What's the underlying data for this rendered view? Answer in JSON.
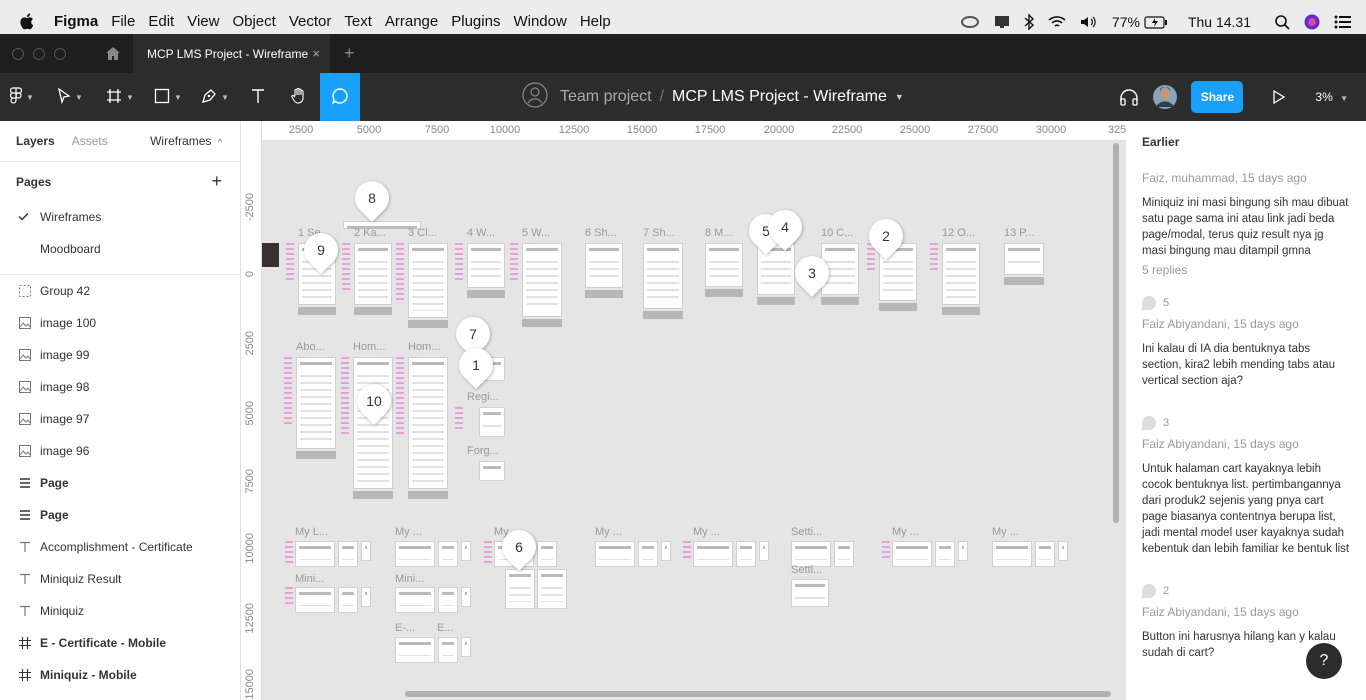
{
  "menubar": {
    "app": "Figma",
    "items": [
      "File",
      "Edit",
      "View",
      "Object",
      "Vector",
      "Text",
      "Arrange",
      "Plugins",
      "Window",
      "Help"
    ],
    "battery": "77%",
    "clock": "Thu 14.31"
  },
  "tabbar": {
    "tab_title": "MCP LMS Project - Wireframe",
    "close": "×",
    "new_tab": "+"
  },
  "toolbar": {
    "team": "Team project",
    "separator": "/",
    "file_name": "MCP LMS Project - Wireframe",
    "share_label": "Share",
    "zoom": "3%"
  },
  "left_panel": {
    "tab_layers": "Layers",
    "tab_assets": "Assets",
    "current_page_switch": "Wireframes",
    "pages_header": "Pages",
    "pages": [
      {
        "label": "Wireframes",
        "selected": true
      },
      {
        "label": "Moodboard",
        "selected": false
      }
    ],
    "layers": [
      {
        "label": "Group 42",
        "icon": "group-icon",
        "bold": false
      },
      {
        "label": "image 100",
        "icon": "image-icon",
        "bold": false
      },
      {
        "label": "image 99",
        "icon": "image-icon",
        "bold": false
      },
      {
        "label": "image 98",
        "icon": "image-icon",
        "bold": false
      },
      {
        "label": "image 97",
        "icon": "image-icon",
        "bold": false
      },
      {
        "label": "image 96",
        "icon": "image-icon",
        "bold": false
      },
      {
        "label": "Page",
        "icon": "component-list-icon",
        "bold": true
      },
      {
        "label": "Page",
        "icon": "component-list-icon",
        "bold": true
      },
      {
        "label": "Accomplishment - Certificate",
        "icon": "text-icon",
        "bold": false
      },
      {
        "label": "Miniquiz Result",
        "icon": "text-icon",
        "bold": false
      },
      {
        "label": "Miniquiz",
        "icon": "text-icon",
        "bold": false
      },
      {
        "label": "E - Certificate - Mobile",
        "icon": "frame-icon",
        "bold": true
      },
      {
        "label": "Miniquiz - Mobile",
        "icon": "frame-icon",
        "bold": true
      }
    ]
  },
  "canvas": {
    "ruler_top": [
      "2500",
      "5000",
      "7500",
      "10000",
      "12500",
      "15000",
      "17500",
      "20000",
      "22500",
      "25000",
      "27500",
      "30000",
      "325"
    ],
    "ruler_left": [
      "-2500",
      "0",
      "2500",
      "5000",
      "7500",
      "10000",
      "12500",
      "15000"
    ],
    "frame_labels": {
      "f1": "1 Se...",
      "f2": "2 Ka...",
      "f3": "3 Cl...",
      "f4": "4 W...",
      "f5": "5 W...",
      "f6": "6 Sh...",
      "f7": "7 Sh...",
      "f8": "8 M...",
      "f10": "10 C...",
      "f12": "12 O...",
      "f13": "13 P...",
      "abo": "Abo...",
      "hom1": "Hom...",
      "hom2": "Hom...",
      "regi": "Regi...",
      "forg": "Forg...",
      "myl": "My L...",
      "my1": "My ...",
      "my2": "My ...",
      "my3": "My ...",
      "my4": "My ...",
      "sett1": "Setti...",
      "my5": "My ...",
      "my6": "My ...",
      "mini1": "Mini...",
      "mini2": "Mini...",
      "sett2": "Setti...",
      "e1": "E-...",
      "e2": "E..."
    },
    "pins": [
      "8",
      "9",
      "5",
      "4",
      "3",
      "2",
      "7",
      "1",
      "10",
      "6"
    ]
  },
  "right_panel": {
    "header": "Earlier",
    "comments": [
      {
        "num": "",
        "author": "Faiz, muhammad, 15 days ago",
        "body": "Miniquiz ini masi bingung sih mau dibuat satu page sama ini atau link jadi beda page/modal, terus quiz result nya jg masi bingung mau ditampil gmna",
        "replies": "5 replies"
      },
      {
        "num": "5",
        "author": "Faiz Abiyandani, 15 days ago",
        "body": "Ini kalau di IA dia bentuknya tabs section, kira2 lebih mending tabs atau vertical section aja?",
        "replies": ""
      },
      {
        "num": "3",
        "author": "Faiz Abiyandani, 15 days ago",
        "body": "Untuk halaman cart kayaknya lebih cocok bentuknya list. pertimbangannya dari produk2 sejenis yang pnya cart page biasanya contentnya berupa list, jadi mental model user kayaknya sudah kebentuk dan lebih familiar ke bentuk list",
        "replies": ""
      },
      {
        "num": "2",
        "author": "Faiz Abiyandani, 15 days ago",
        "body": "Button ini harusnya hilang kan y kalau sudah di cart?",
        "replies": ""
      }
    ],
    "help": "?"
  }
}
